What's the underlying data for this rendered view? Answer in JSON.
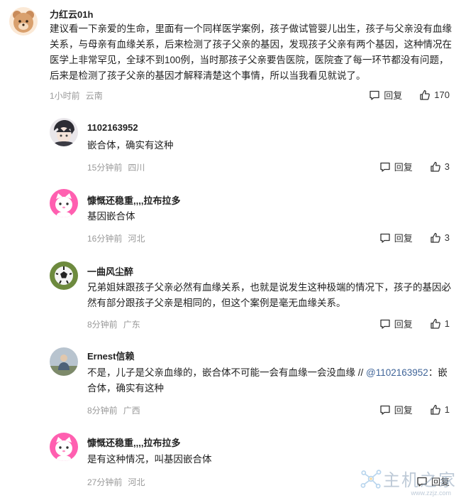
{
  "comments": [
    {
      "username": "力红云01h",
      "text": "建议看一下亲爱的生命，里面有一个同样医学案例，孩子做试管婴儿出生，孩子与父亲没有血缘关系，与母亲有血缘关系，后来检测了孩子父亲的基因，发现孩子父亲有两个基因，这种情况在医学上非常罕见，全球不到100例，当时那孩子父亲要告医院，医院查了每一环节都没有问题，后来是检测了孩子父亲的基因才解释清楚这个事情，所以当我看见就说了。",
      "time": "1小时前",
      "location": "云南",
      "reply_label": "回复",
      "likes": "170"
    },
    {
      "username": "1102163952",
      "text": "嵌合体，确实有这种",
      "time": "15分钟前",
      "location": "四川",
      "reply_label": "回复",
      "likes": "3"
    },
    {
      "username": "慷慨还稳重,,,,拉布拉多",
      "text": "基因嵌合体",
      "time": "16分钟前",
      "location": "河北",
      "reply_label": "回复",
      "likes": "3"
    },
    {
      "username": "一曲风尘醉",
      "text": "兄弟姐妹跟孩子父亲必然有血缘关系，也就是说发生这种极端的情况下，孩子的基因必然有部分跟孩子父亲是相同的，但这个案例是毫无血缘关系。",
      "time": "8分钟前",
      "location": "广东",
      "reply_label": "回复",
      "likes": "1"
    },
    {
      "username": "Ernest信赖",
      "text_before": "不是，儿子是父亲血缘的，嵌合体不可能一会有血缘一会没血缘 // ",
      "mention": "@1102163952",
      "text_after": "：嵌合体，确实有这种",
      "time": "8分钟前",
      "location": "广西",
      "reply_label": "回复",
      "likes": "1"
    },
    {
      "username": "慷慨还稳重,,,,拉布拉多",
      "text": "是有这种情况，叫基因嵌合体",
      "time": "27分钟前",
      "location": "河北",
      "reply_label": "回复",
      "likes": ""
    }
  ],
  "icons": {
    "reply": "comment-bubble-icon",
    "like": "thumbs-up-icon"
  },
  "colors": {
    "meta": "#999999",
    "mention": "#406599",
    "text": "#222222"
  },
  "watermark": {
    "text": "主机之家",
    "sub": "www.zzjz.com"
  }
}
